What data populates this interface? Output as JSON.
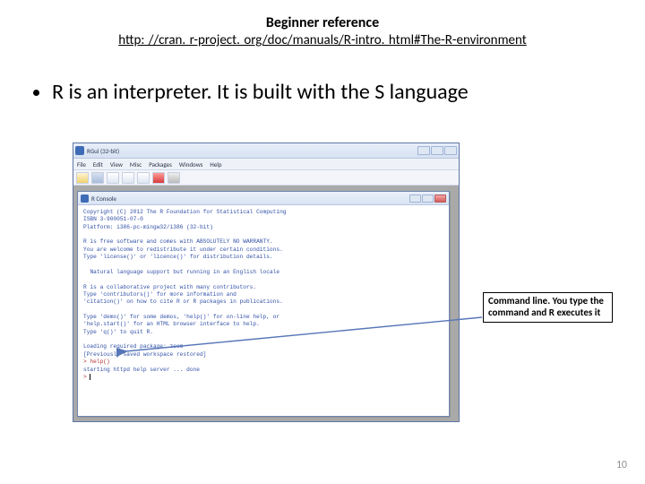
{
  "header": {
    "title": "Beginner reference",
    "link": "http: //cran. r-project. org/doc/manuals/R-intro. html#The-R-environment"
  },
  "bullet": "R is an interpreter. It is built with the S language",
  "rgui": {
    "title": "RGui (32-bit)",
    "menus": [
      "File",
      "Edit",
      "View",
      "Misc",
      "Packages",
      "Windows",
      "Help"
    ],
    "console_title": "R Console",
    "console_text": "Copyright (C) 2012 The R Foundation for Statistical Computing\nISBN 3-900051-07-0\nPlatform: i386-pc-mingw32/i386 (32-bit)\n\nR is free software and comes with ABSOLUTELY NO WARRANTY.\nYou are welcome to redistribute it under certain conditions.\nType 'license()' or 'licence()' for distribution details.\n\n  Natural language support but running in an English locale\n\nR is a collaborative project with many contributors.\nType 'contributors()' for more information and\n'citation()' on how to cite R or R packages in publications.\n\nType 'demo()' for some demos, 'help()' for on-line help, or\n'help.start()' for an HTML browser interface to help.\nType 'q()' to quit R.\n\nLoading required package: zoom\n[Previously saved workspace restored]\n",
    "prompt_cmd": "> help()",
    "prompt_out": "starting httpd help server ... done",
    "prompt_empty": "> "
  },
  "callout": "Command line. You type the command and R executes it",
  "page_number": "10"
}
